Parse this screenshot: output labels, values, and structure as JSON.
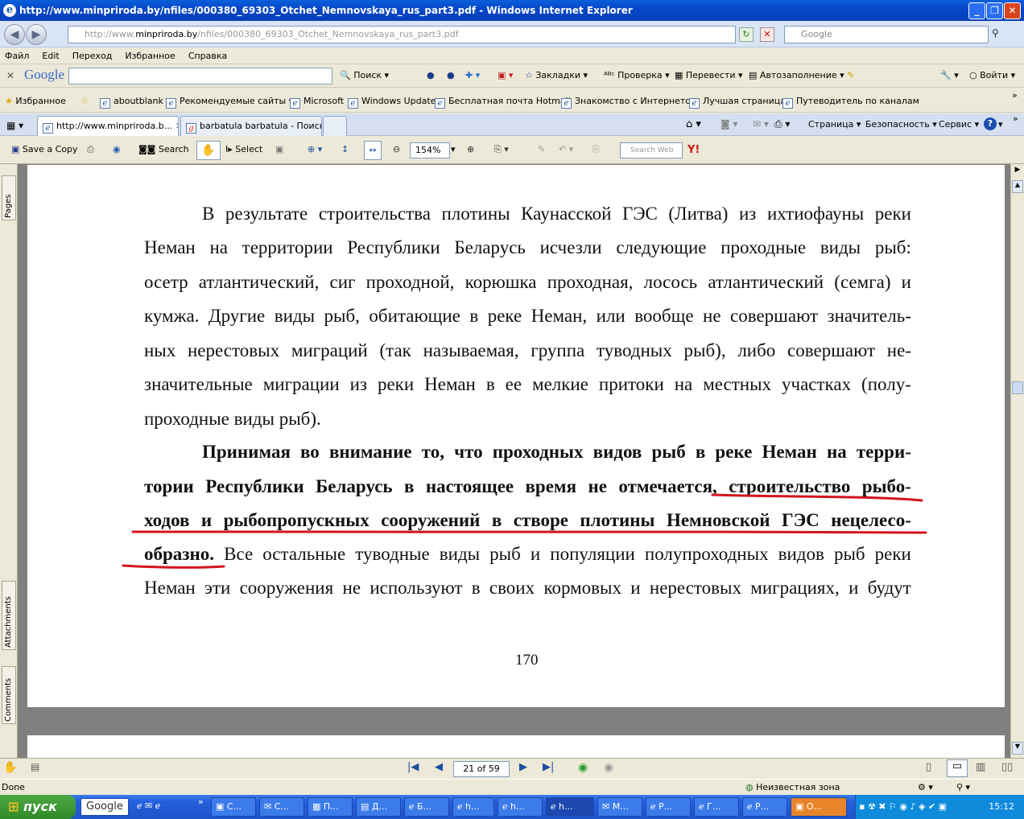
{
  "window": {
    "title": "http://www.minpriroda.by/nfiles/000380_69303_Otchet_Nemnovskaya_rus_part3.pdf - Windows Internet Explorer",
    "min_symbol": "_",
    "max_symbol": "❐",
    "close_symbol": "✕"
  },
  "address": {
    "prefix": "http://www.",
    "host": "minpriroda.by",
    "path": "/nfiles/000380_69303_Otchet_Nemnovskaya_rus_part3.pdf",
    "search_placeholder": "Google"
  },
  "menu": [
    "Файл",
    "Edit",
    "Переход",
    "Избранное",
    "Справка"
  ],
  "google_toolbar": {
    "logo": "Google",
    "search": "Поиск",
    "bookmarks": "Закладки",
    "spell": "Проверка",
    "translate": "Перевести",
    "autofill": "Автозаполнение",
    "signin": "Войти"
  },
  "favorites": {
    "label": "Избранное",
    "items": [
      "aboutblank",
      "Рекомендуемые сайты",
      "Microsoft",
      "Windows Update",
      "Бесплатная почта Hotmail",
      "Знакомство с Интернетом",
      "Лучшая страница",
      "Путеводитель по каналам"
    ]
  },
  "tabs": [
    "http://www.minpriroda.b...",
    "barbatula barbatula - Поиск ..."
  ],
  "ie_commands": [
    "Страница",
    "Безопасность",
    "Сервис"
  ],
  "reader": {
    "save": "Save a Copy",
    "search": "Search",
    "select": "Select",
    "zoom": "154%",
    "search_web": "Search Web"
  },
  "side_tabs": [
    "Pages",
    "Attachments",
    "Comments"
  ],
  "document": {
    "lines": [
      [
        "В",
        "результате",
        "строительства",
        "плотины",
        "Каунасской",
        "ГЭС",
        "(Литва)",
        "из",
        "ихтиофауны",
        "реки"
      ],
      [
        "Неман",
        "на",
        "территории",
        "Республики",
        "Беларусь",
        "исчезли",
        "следующие",
        "проходные",
        "виды",
        "рыб:"
      ],
      [
        "осетр",
        "атлантический,",
        "сиг",
        "проходной,",
        "корюшка",
        "проходная,",
        "лосось",
        "атлантический",
        "(семга)",
        "и"
      ],
      [
        "кумжа.",
        "Другие",
        "виды",
        "рыб,",
        "обитающие",
        "в",
        "реке",
        "Неман,",
        "или",
        "вообще",
        "не",
        "совершают",
        "значитель-"
      ],
      [
        "ных",
        "нерестовых",
        "миграций",
        "(так",
        "называемая,",
        "группа",
        "туводных",
        "рыб),",
        "либо",
        "совершают",
        "не-"
      ],
      [
        "значительные",
        "миграции",
        "из",
        "реки",
        "Неман",
        "в",
        "ее",
        "мелкие",
        "притоки",
        "на",
        "местных",
        "участках",
        "(полу-"
      ],
      [
        "проходные виды рыб)."
      ],
      [
        "Принимая",
        "во",
        "внимание",
        "то,",
        "что",
        "проходных",
        "видов",
        "рыб",
        "в",
        "реке",
        "Неман",
        "на",
        "терри-"
      ],
      [
        "тории",
        "Республики",
        "Беларусь",
        "в",
        "настоящее",
        "время",
        "не",
        "отмечается,",
        "строительство",
        "рыбо-"
      ],
      [
        "ходов",
        "и",
        "рыбопропускных",
        "сооружений",
        "в",
        "створе",
        "плотины",
        "Немновской",
        "ГЭС",
        "нецелесо-"
      ],
      [
        "Неман",
        "эти",
        "сооружения",
        "не",
        "используют",
        "в",
        "своих",
        "кормовых",
        "и",
        "нерестовых",
        "миграциях,",
        "и",
        "будут"
      ]
    ],
    "line11_bold": "образно.",
    "line11_rest": [
      "Все",
      "остальные",
      "туводные",
      "виды",
      "рыб",
      "и",
      "популяции",
      "полупроходных",
      "видов",
      "рыб",
      "реки"
    ],
    "page_number": "170"
  },
  "pagenav": {
    "page": "21 of 59"
  },
  "status": {
    "left": "Done",
    "zone": "Неизвестная зона"
  },
  "taskbar": {
    "start": "пуск",
    "google": "Google",
    "tasks": [
      "С...",
      "С...",
      "П...",
      "Д...",
      "Б...",
      "h...",
      "h...",
      "h...",
      "М...",
      "Р...",
      "Г...",
      "Р...",
      "О..."
    ],
    "clock": "15:12"
  },
  "colors": {
    "title_bar": "#0548c8",
    "underline": "#d4141c",
    "page_bg": "#ffffff",
    "doc_bg": "#808080"
  }
}
